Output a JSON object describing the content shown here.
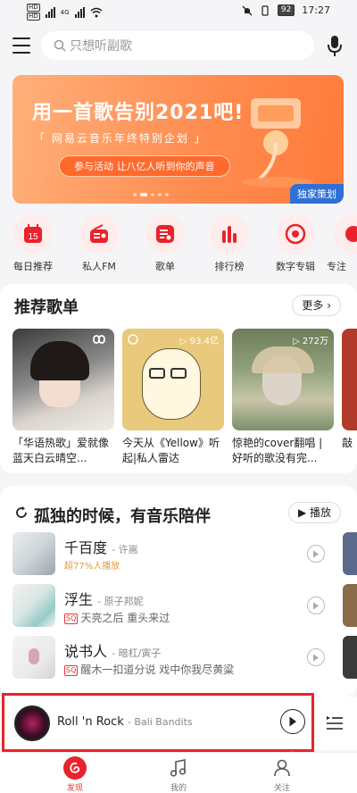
{
  "status_bar": {
    "hd1": "HD",
    "hd2": "HD",
    "net": "4G",
    "battery": "92",
    "time": "17:27"
  },
  "search": {
    "placeholder": "只想听副歌"
  },
  "banner": {
    "title": "用一首歌告别2021吧!",
    "subtitle": "「 网易云音乐年终特别企划 」",
    "cta": "参与活动 让八亿人听到你的声音",
    "tag": "独家策划"
  },
  "shortcuts": [
    {
      "label": "每日推荐",
      "icon": "calendar-icon",
      "badge": "15"
    },
    {
      "label": "私人FM",
      "icon": "radio-icon"
    },
    {
      "label": "歌单",
      "icon": "playlist-icon"
    },
    {
      "label": "排行榜",
      "icon": "chart-icon"
    },
    {
      "label": "数字专辑",
      "icon": "album-icon"
    },
    {
      "label": "专注",
      "icon": "focus-icon"
    }
  ],
  "recommend": {
    "title": "推荐歌单",
    "more": "更多",
    "playlists": [
      {
        "title": "「华语热歌」爱就像蓝天白云晴空...",
        "count": ""
      },
      {
        "title": "今天从《Yellow》听起|私人雷达",
        "count": "93.4亿"
      },
      {
        "title": "惊艳的cover翻唱 | 好听的歌没有完...",
        "count": "272万"
      },
      {
        "title": "敲",
        "count": ""
      }
    ]
  },
  "lonely": {
    "title": "孤独的时候，有音乐陪伴",
    "play": "播放",
    "songs": [
      {
        "name": "千百度",
        "artist": "- 许嵩",
        "sub": "超77%人播放",
        "sq": false,
        "hot": true
      },
      {
        "name": "浮生",
        "artist": "- 原子邦妮",
        "sub": "天亮之后 重头来过",
        "sq": true,
        "hot": false
      },
      {
        "name": "说书人",
        "artist": "- 暗杠/寅子",
        "sub": "醒木一扣道分说 戏中你我尽黄粱",
        "sq": true,
        "hot": false
      }
    ]
  },
  "mini_player": {
    "title": "Roll 'n Rock",
    "artist": "- Bali Bandits"
  },
  "tabs": [
    {
      "label": "发现",
      "active": true
    },
    {
      "label": "我的",
      "active": false
    },
    {
      "label": "关注",
      "active": false
    }
  ],
  "colors": {
    "accent": "#e8232b",
    "banner": "#ff8a4e"
  }
}
